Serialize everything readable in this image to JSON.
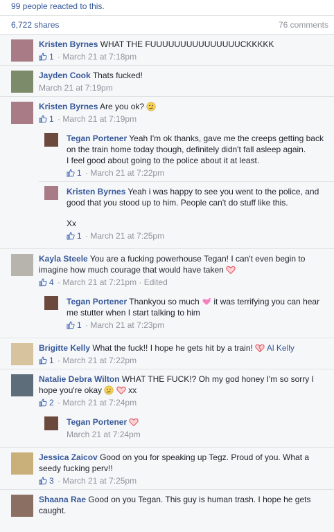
{
  "header": {
    "reacted_text": "99 people reacted to this.",
    "shares": "6,722 shares",
    "comments": "76 comments"
  },
  "comments": [
    {
      "name": "Kristen Byrnes",
      "text": "WHAT THE FUUUUUUUUUUUUUUUCKKKKK",
      "likes": "1",
      "time": "March 21 at 7:18pm",
      "avatar_color": "#a87b86"
    },
    {
      "name": "Jayden Cook",
      "text": "Thats fucked!",
      "time": "March 21 at 7:19pm",
      "avatar_color": "#7c8b6a"
    },
    {
      "name": "Kristen Byrnes",
      "text": "Are you ok?",
      "likes": "1",
      "time": "March 21 at 7:19pm",
      "avatar_color": "#a87b86"
    },
    {
      "name": "Tegan Portener",
      "text_line1": "Yeah I'm ok thanks, gave me the creeps getting back on the train home today though, definitely didn't fall asleep again.",
      "text_line2": "I feel good about going to the police about it at least.",
      "likes": "1",
      "time": "March 21 at 7:22pm",
      "avatar_color": "#6b4a3d"
    },
    {
      "name": "Kristen Byrnes",
      "text_line1": "Yeah i was happy to see you went to the police, and good that you stood up to him. People can't do stuff like this.",
      "text_line2": "Xx",
      "likes": "1",
      "time": "March 21 at 7:25pm",
      "avatar_color": "#a87b86"
    },
    {
      "name": "Kayla Steele",
      "text": "You are a fucking powerhouse Tegan! I can't even begin to imagine how much courage that would have taken",
      "likes": "4",
      "time": "March 21 at 7:21pm · Edited",
      "avatar_color": "#b7b3ad"
    },
    {
      "name": "Tegan Portener",
      "text_a": "Thankyou so much",
      "text_b": "it was terrifying you can hear me stutter when I start talking to him",
      "likes": "1",
      "time": "March 21 at 7:23pm",
      "avatar_color": "#6b4a3d"
    },
    {
      "name": "Brigitte Kelly",
      "text": "What the fuck!! I hope he gets hit by a train!",
      "tag": "Al Kelly",
      "likes": "1",
      "time": "March 21 at 7:22pm",
      "avatar_color": "#d7c39e"
    },
    {
      "name": "Natalie Debra Wilton",
      "text_a": "WHAT THE FUCK!? Oh my god honey I'm so sorry I hope you're okay",
      "text_b": "xx",
      "likes": "2",
      "time": "March 21 at 7:24pm",
      "avatar_color": "#5e6d7a"
    },
    {
      "name": "Tegan Portener",
      "time": "March 21 at 7:24pm",
      "avatar_color": "#6b4a3d"
    },
    {
      "name": "Jessica Zaicov",
      "text": "Good on you for speaking up Tegz. Proud of you. What a seedy fucking perv!!",
      "likes": "3",
      "time": "March 21 at 7:25pm",
      "avatar_color": "#c9b07a"
    },
    {
      "name": "Shaana Rae",
      "text": "Good on you Tegan. This guy is human trash. I hope he gets caught.",
      "avatar_color": "#8b6f62"
    }
  ]
}
